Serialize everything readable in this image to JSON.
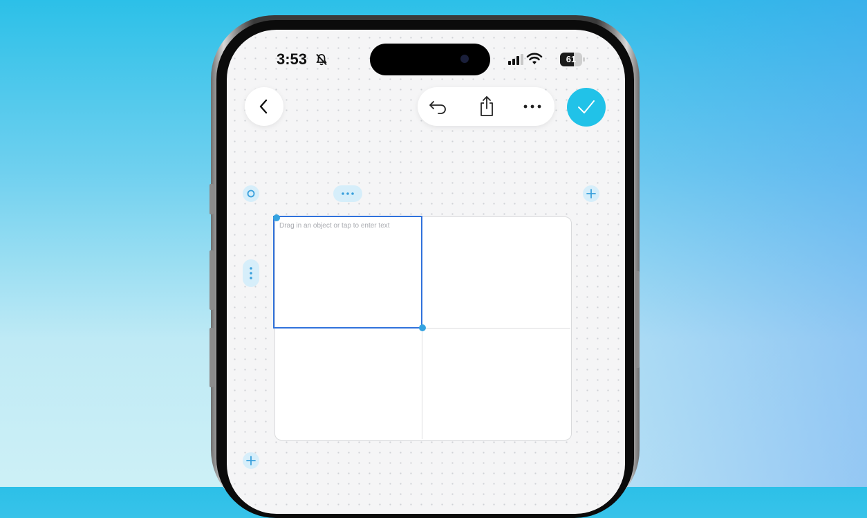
{
  "status_bar": {
    "time": "3:53",
    "battery": "61",
    "battery_level": 0.61,
    "icons": [
      "bell-slash-icon",
      "cellular-signal-icon",
      "wifi-icon",
      "battery-icon"
    ]
  },
  "toolbar": {
    "back": "chevron-left-icon",
    "actions": [
      "undo-icon",
      "share-icon",
      "more-icon"
    ],
    "done": "checkmark-icon"
  },
  "table": {
    "rows": 2,
    "columns": 2,
    "selected_cell_placeholder": "Drag in an object or tap to enter text"
  },
  "colors": {
    "accent": "#21c2e8",
    "selection": "#3072dc",
    "handle": "#d6eefa",
    "handle_icon": "#3aa0dc"
  }
}
